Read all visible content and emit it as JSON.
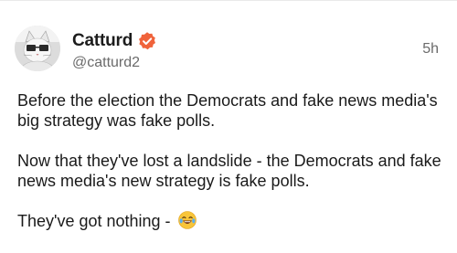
{
  "author": {
    "display_name": "Catturd",
    "handle": "@catturd2",
    "verified_badge_icon": "verified-badge-icon",
    "badge_color": "#f0633b"
  },
  "timestamp": "5h",
  "post": {
    "paragraphs": [
      "Before the election the Democrats and fake news media's big strategy was fake polls.",
      "Now that they've lost a landslide - the Democrats and fake news media's new strategy is fake polls.",
      "They've got nothing - "
    ],
    "trailing_emoji": "laughing-with-tears-emoji"
  }
}
